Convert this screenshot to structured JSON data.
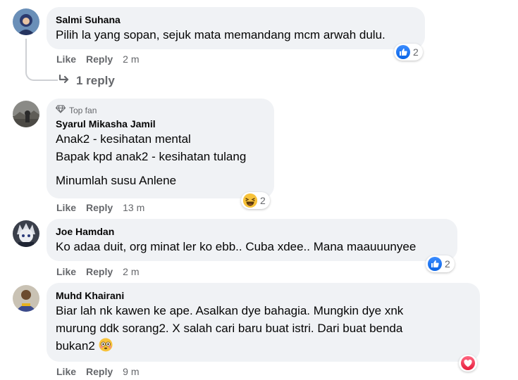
{
  "comments": [
    {
      "name": "Salmi Suhana",
      "lines": [
        "Pilih la yang sopan, sejuk mata memandang mcm arwah dulu."
      ],
      "like_label": "Like",
      "reply_label": "Reply",
      "time": "2 m",
      "reaction_icon": "like-icon",
      "reaction_count": "2"
    },
    {
      "badge": "Top fan",
      "badge_icon": "diamond-icon",
      "name": "Syarul Mikasha Jamil",
      "lines": [
        "Anak2 - kesihatan mental",
        "Bapak kpd anak2 - kesihatan tulang",
        "Minumlah susu Anlene"
      ],
      "like_label": "Like",
      "reply_label": "Reply",
      "time": "13 m",
      "reaction_icon": "haha-icon",
      "reaction_count": "2"
    },
    {
      "name": "Joe Hamdan",
      "lines": [
        "Ko adaa duit, org minat ler ko ebb.. Cuba xdee.. Mana maauuunyee"
      ],
      "like_label": "Like",
      "reply_label": "Reply",
      "time": "2 m",
      "reaction_icon": "like-icon",
      "reaction_count": "2"
    },
    {
      "name": "Muhd Khairani",
      "lines": [
        "Biar lah nk kawen ke ape. Asalkan dye bahagia. Mungkin dye xnk",
        "murung ddk sorang2. X salah cari baru buat istri. Dari buat benda",
        "bukan2"
      ],
      "trailing_emoji": "flushed-face-icon",
      "like_label": "Like",
      "reply_label": "Reply",
      "time": "9 m",
      "reaction_icon": "love-icon"
    }
  ],
  "view_replies": {
    "label": "1 reply",
    "icon": "reply-arrow-icon"
  },
  "colors": {
    "bubble": "#f0f2f5",
    "secondary_text": "#65676b",
    "like_blue": "#1877f2",
    "love_red": "#f33e58"
  }
}
